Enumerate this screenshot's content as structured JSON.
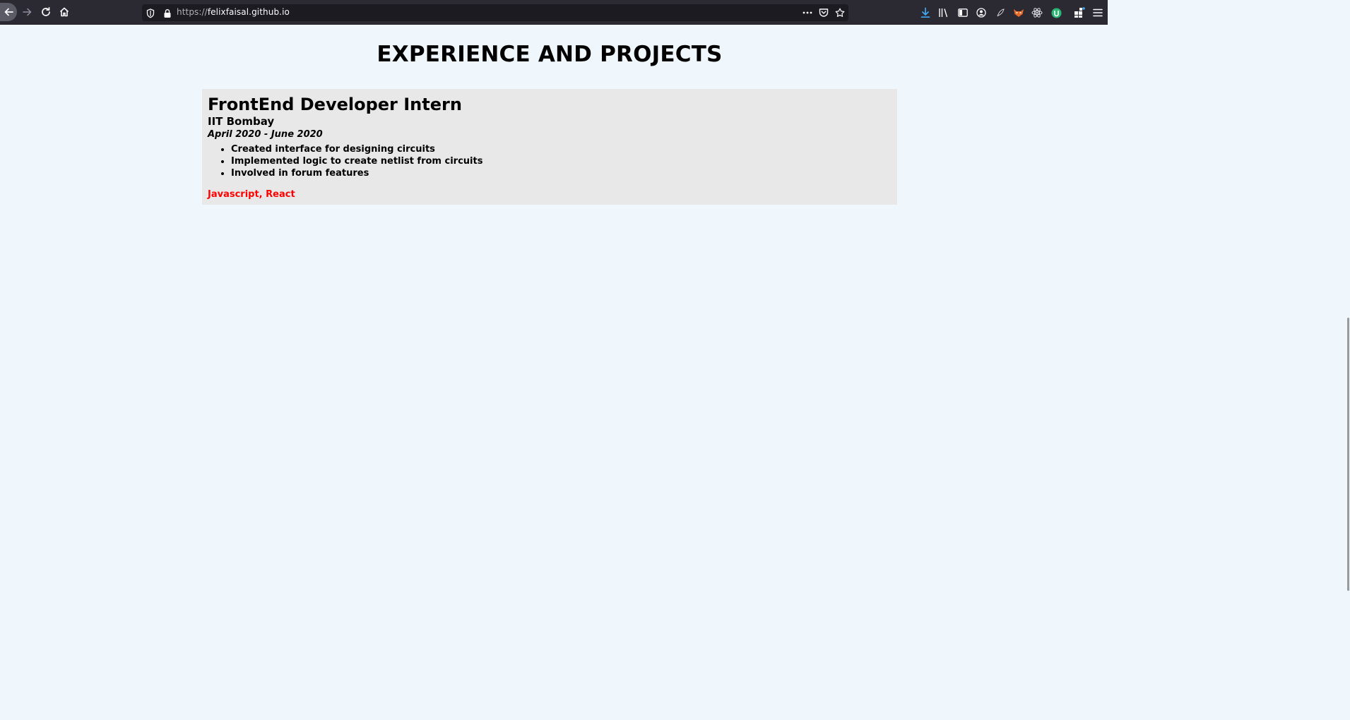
{
  "browser": {
    "url_scheme": "https://",
    "url_host": "felixfaisal.github.io",
    "icons": {
      "back": "back-arrow-icon",
      "forward": "forward-arrow-icon",
      "reload": "reload-icon",
      "home": "home-icon",
      "tracking_protection": "shield-icon",
      "secure": "lock-icon",
      "page_actions": "more-dots-icon",
      "pocket": "pocket-icon",
      "bookmark": "star-icon",
      "downloads": "download-icon",
      "library": "library-icon",
      "sidebar": "sidebar-icon",
      "account": "account-icon",
      "menu": "hamburger-menu-icon"
    },
    "accent_download": "#3fa9f5"
  },
  "page": {
    "title": "EXPERIENCE AND PROJECTS",
    "background": "#eff7fd",
    "experience": [
      {
        "role": "FrontEnd Developer Intern",
        "company": "IIT Bombay",
        "dates": "April 2020 - June 2020",
        "points": [
          "Created interface for designing circuits",
          "Implemented logic to create netlist from circuits",
          "Involved in forum features"
        ],
        "skills": "Javascript, React",
        "skills_color": "#ff0000",
        "card_background": "#e8e8e8"
      }
    ]
  }
}
